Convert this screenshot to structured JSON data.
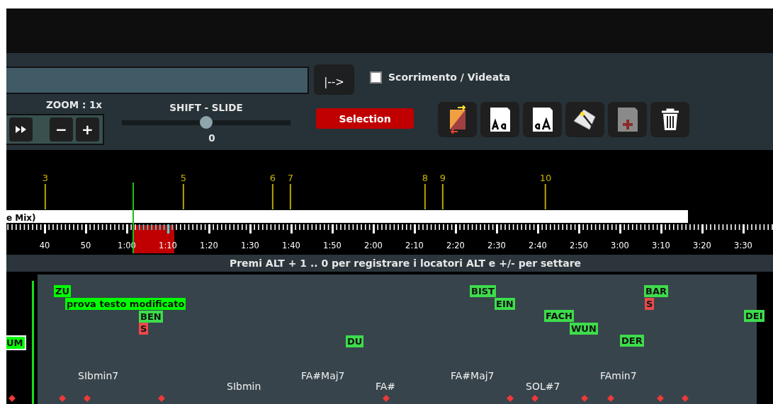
{
  "toolbar": {
    "jump_button": "|-->",
    "scroll_checkbox": {
      "label": "Scorrimento / Videata",
      "checked": false
    },
    "zoom_label": "ZOOM : 1x",
    "zoom_buttons": [
      "−",
      "+"
    ],
    "shift_slide": {
      "label": "SHIFT - SLIDE",
      "level": 0.5,
      "reading": "0"
    },
    "selection_button": "Selection"
  },
  "timeline": {
    "markers": [
      "3",
      "5",
      "6",
      "7",
      "8",
      "9",
      "10"
    ],
    "track_label": "e Mix)",
    "ruler_labels": [
      "40",
      "50",
      "1:00",
      "1:10",
      "1:20",
      "1:30",
      "1:40",
      "1:50",
      "2:00",
      "2:10",
      "2:20",
      "2:30",
      "2:40",
      "2:50",
      "3:00",
      "3:10",
      "3:20",
      "3:30"
    ]
  },
  "hint": "Premi ALT + 1 .. 0 per registrare i locatori ALT e +/- per settare",
  "lyrics": [
    {
      "text": "UM",
      "color": "#00ff00"
    },
    {
      "text": "ZU",
      "color": "#00ff00"
    },
    {
      "text": "prova testo modificato",
      "color": "#00ff00"
    },
    {
      "text": "BEN",
      "color": "#3ddc4c"
    },
    {
      "text": "S",
      "color": "#e84a4a"
    },
    {
      "text": "DU",
      "color": "#3ddc4c"
    },
    {
      "text": "BIST",
      "color": "#3ddc4c"
    },
    {
      "text": "EIN",
      "color": "#3ddc4c"
    },
    {
      "text": "FACH",
      "color": "#3ddc4c"
    },
    {
      "text": "WUN",
      "color": "#3ddc4c"
    },
    {
      "text": "DER",
      "color": "#3ddc4c"
    },
    {
      "text": "BAR",
      "color": "#3ddc4c"
    },
    {
      "text": "S",
      "color": "#e84a4a"
    },
    {
      "text": "DEI",
      "color": "#3ddc4c"
    }
  ],
  "chords": [
    "SIbmin7",
    "SIbmin",
    "FA#Maj7",
    "FA#",
    "FA#Maj7",
    "SOL#7",
    "FAmin7"
  ]
}
